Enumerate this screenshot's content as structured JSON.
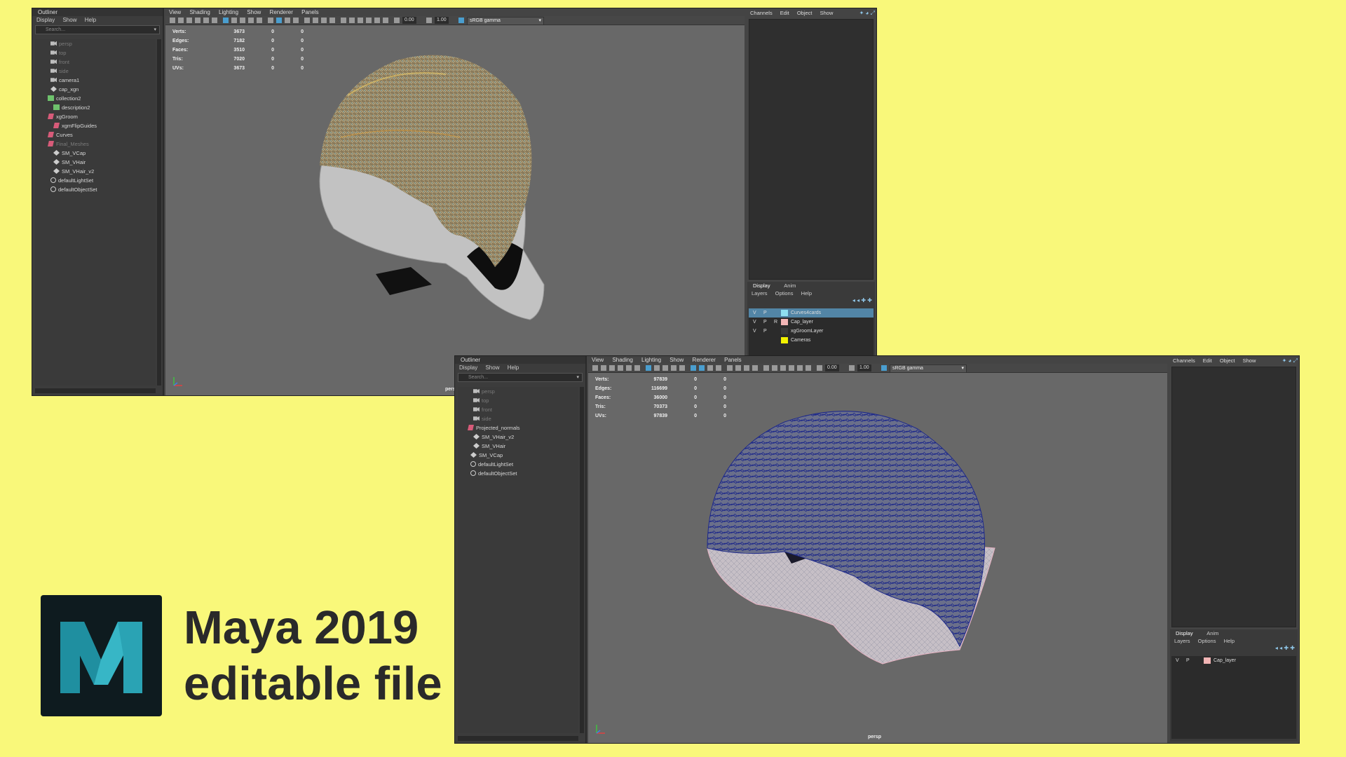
{
  "colors": {
    "background": "#f9f87a",
    "selection": "#5285a6",
    "accent": "#4a9ecf"
  },
  "window1": {
    "outliner": {
      "title": "Outliner",
      "menu": [
        "Display",
        "Show",
        "Help"
      ],
      "search_placeholder": "Search...",
      "items": [
        {
          "label": "persp",
          "icon": "camera-icon",
          "dim": true
        },
        {
          "label": "top",
          "icon": "camera-icon",
          "dim": true
        },
        {
          "label": "front",
          "icon": "camera-icon",
          "dim": true
        },
        {
          "label": "side",
          "icon": "camera-icon",
          "dim": true
        },
        {
          "label": "camera1",
          "icon": "camera-icon"
        },
        {
          "label": "cap_xgn",
          "icon": "transform-icon"
        },
        {
          "label": "collection2",
          "icon": "collection-icon"
        },
        {
          "label": "description2",
          "icon": "description-icon"
        },
        {
          "label": "xgGroom",
          "icon": "group-icon"
        },
        {
          "label": "xgmFlipGuides",
          "icon": "group-icon"
        },
        {
          "label": "Curves",
          "icon": "group-icon"
        },
        {
          "label": "Final_Meshes",
          "icon": "group-icon",
          "dim": true
        },
        {
          "label": "SM_VCap",
          "icon": "transform-icon"
        },
        {
          "label": "SM_VHair",
          "icon": "transform-icon"
        },
        {
          "label": "SM_VHair_v2",
          "icon": "transform-icon"
        },
        {
          "label": "defaultLightSet",
          "icon": "set-icon"
        },
        {
          "label": "defaultObjectSet",
          "icon": "set-icon"
        }
      ]
    },
    "viewport": {
      "menu": [
        "View",
        "Shading",
        "Lighting",
        "Show",
        "Renderer",
        "Panels"
      ],
      "exposure": "0.00",
      "gamma": "1.00",
      "colorspace": "sRGB gamma",
      "hud": [
        {
          "label": "Verts:",
          "v": "3673",
          "a": "0",
          "b": "0"
        },
        {
          "label": "Edges:",
          "v": "7182",
          "a": "0",
          "b": "0"
        },
        {
          "label": "Faces:",
          "v": "3510",
          "a": "0",
          "b": "0"
        },
        {
          "label": "Tris:",
          "v": "7020",
          "a": "0",
          "b": "0"
        },
        {
          "label": "UVs:",
          "v": "3673",
          "a": "0",
          "b": "0"
        }
      ],
      "camera_label": "persp"
    },
    "channel_box": {
      "menu": [
        "Channels",
        "Edit",
        "Object",
        "Show"
      ],
      "layer_tabs": [
        "Display",
        "Anim"
      ],
      "layer_menu": [
        "Layers",
        "Options",
        "Help"
      ],
      "layers": [
        {
          "v": "V",
          "p": "P",
          "r": "",
          "name": "Curves4cards",
          "color": "#8fdff0",
          "selected": true
        },
        {
          "v": "V",
          "p": "P",
          "r": "R",
          "name": "Cap_layer",
          "color": "#f2b5b5"
        },
        {
          "v": "V",
          "p": "P",
          "r": "",
          "name": "xgGroomLayer",
          "color": "#3a3a3a"
        },
        {
          "v": "",
          "p": "",
          "r": "",
          "name": "Cameras",
          "color": "#f2f200"
        }
      ]
    }
  },
  "window2": {
    "outliner": {
      "title": "Outliner",
      "menu": [
        "Display",
        "Show",
        "Help"
      ],
      "search_placeholder": "Search...",
      "items": [
        {
          "label": "persp",
          "icon": "camera-icon",
          "dim": true
        },
        {
          "label": "top",
          "icon": "camera-icon",
          "dim": true
        },
        {
          "label": "front",
          "icon": "camera-icon",
          "dim": true
        },
        {
          "label": "side",
          "icon": "camera-icon",
          "dim": true
        },
        {
          "label": "Projected_normals",
          "icon": "group-icon"
        },
        {
          "label": "SM_VHair_v2",
          "icon": "transform-icon"
        },
        {
          "label": "SM_VHair",
          "icon": "transform-icon"
        },
        {
          "label": "SM_VCap",
          "icon": "transform-icon"
        },
        {
          "label": "defaultLightSet",
          "icon": "set-icon"
        },
        {
          "label": "defaultObjectSet",
          "icon": "set-icon"
        }
      ]
    },
    "viewport": {
      "menu": [
        "View",
        "Shading",
        "Lighting",
        "Show",
        "Renderer",
        "Panels"
      ],
      "exposure": "0.00",
      "gamma": "1.00",
      "colorspace": "sRGB gamma",
      "hud": [
        {
          "label": "Verts:",
          "v": "97839",
          "a": "0",
          "b": "0"
        },
        {
          "label": "Edges:",
          "v": "116699",
          "a": "0",
          "b": "0"
        },
        {
          "label": "Faces:",
          "v": "36000",
          "a": "0",
          "b": "0"
        },
        {
          "label": "Tris:",
          "v": "70373",
          "a": "0",
          "b": "0"
        },
        {
          "label": "UVs:",
          "v": "97839",
          "a": "0",
          "b": "0"
        }
      ],
      "camera_label": "persp"
    },
    "channel_box": {
      "menu": [
        "Channels",
        "Edit",
        "Object",
        "Show"
      ],
      "layer_tabs": [
        "Display",
        "Anim"
      ],
      "layer_menu": [
        "Layers",
        "Options",
        "Help"
      ],
      "layers": [
        {
          "v": "V",
          "p": "P",
          "r": "",
          "name": "Cap_layer",
          "color": "#f2b5b5"
        }
      ]
    }
  },
  "promo": {
    "line1": "Maya 2019",
    "line2": "editable file",
    "logo_icon": "maya-logo-icon"
  }
}
